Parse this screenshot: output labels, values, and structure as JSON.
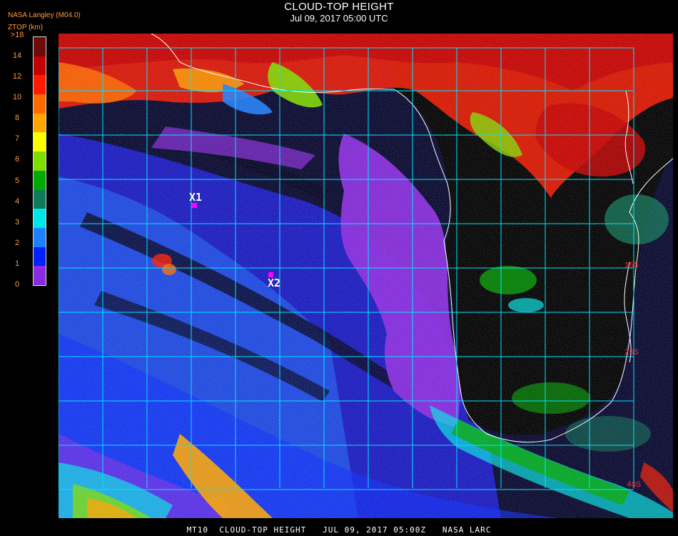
{
  "header": {
    "title": "CLOUD-TOP HEIGHT",
    "date": "Jul 09, 2017 05:00 UTC",
    "source": "NASA Langley (M04.0)",
    "units": "ZTOP (km)"
  },
  "colorbar": {
    "labels": [
      ">18",
      "14",
      "12",
      "10",
      "8",
      "7",
      "6",
      "5",
      "4",
      "3",
      "2",
      "1",
      "0"
    ],
    "colors": [
      "#6e0a0a",
      "#c40000",
      "#ff1a00",
      "#ff6a00",
      "#ffa500",
      "#ffff00",
      "#7fdd00",
      "#00aa00",
      "#0f7a5a",
      "#00e6e6",
      "#1e7fff",
      "#0022ff",
      "#8a2be2"
    ]
  },
  "map": {
    "grid_color": "#00e5ff",
    "coast_color": "#ffffff",
    "lat_labels": [
      "15S",
      "25S",
      "40S"
    ],
    "markers": [
      {
        "label": "X1"
      },
      {
        "label": "X2"
      }
    ]
  },
  "footer": {
    "text": "MT10  CLOUD-TOP HEIGHT   JUL 09, 2017 05:00Z   NASA LARC"
  }
}
